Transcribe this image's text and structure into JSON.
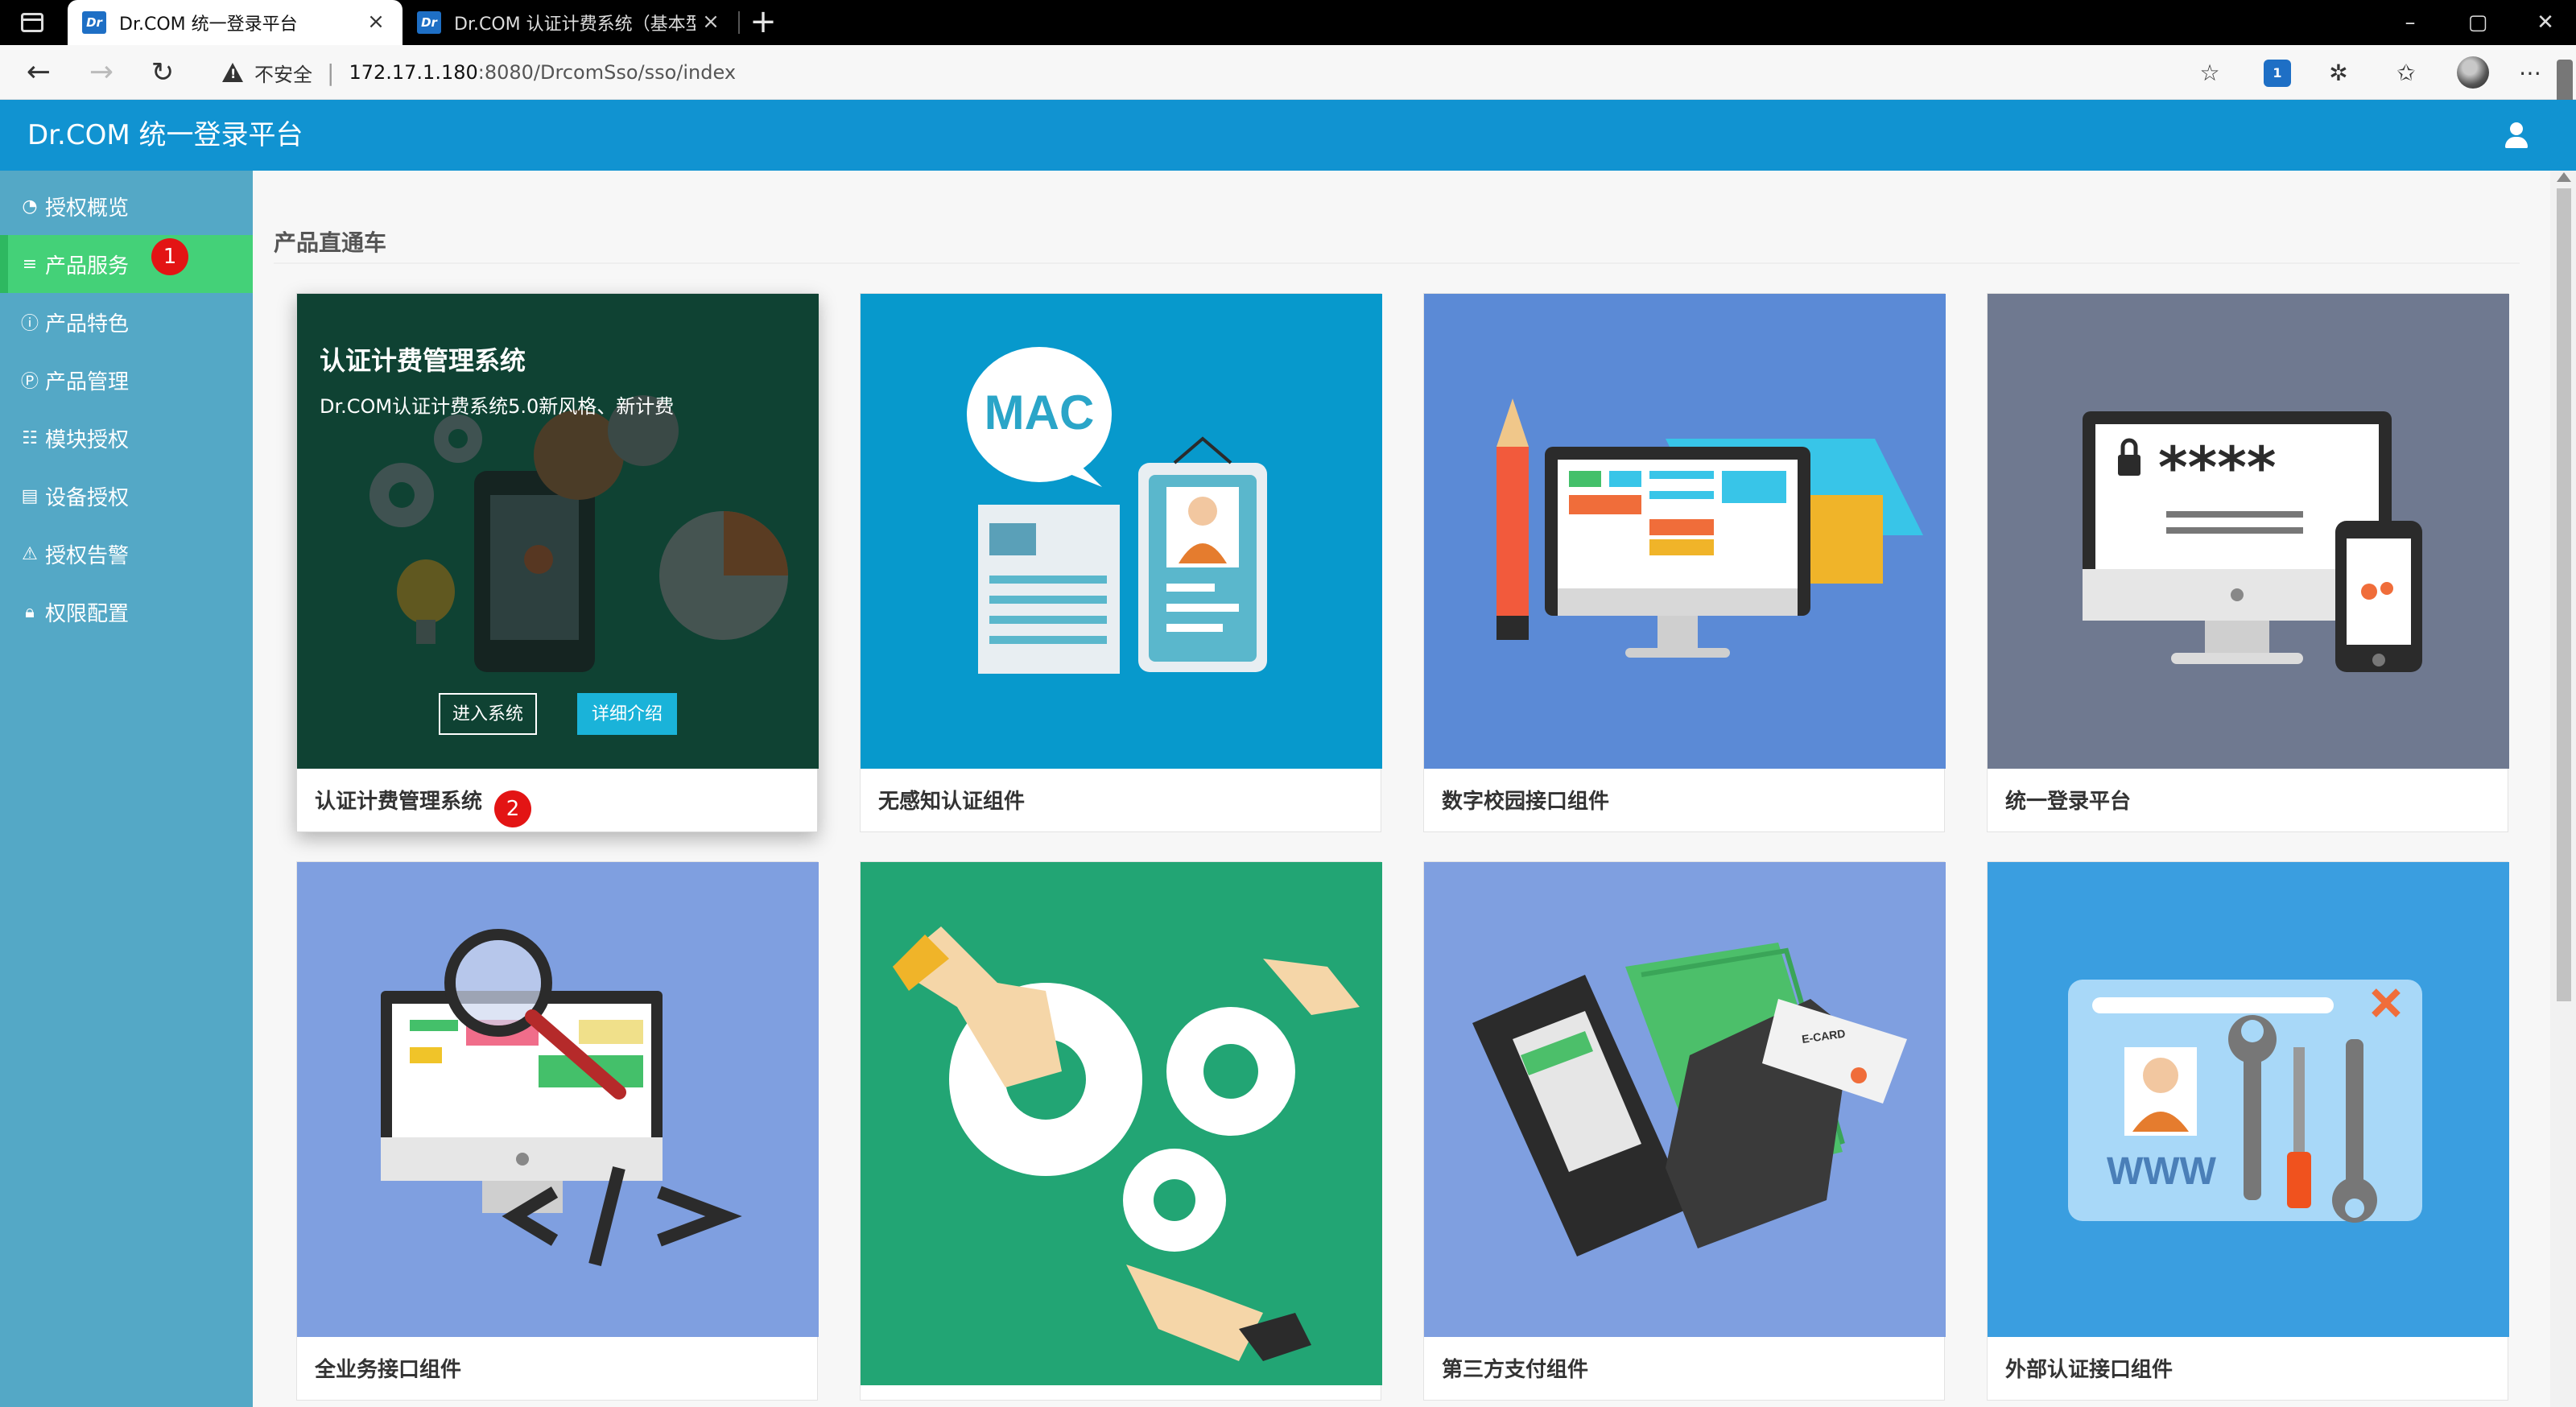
{
  "browser": {
    "tabs": [
      {
        "label": "Dr.COM 统一登录平台",
        "favicon": "Dr",
        "active": true
      },
      {
        "label": "Dr.COM 认证计费系统（基本型）",
        "favicon": "Dr",
        "active": false
      }
    ],
    "address": {
      "security_label": "不安全",
      "url_host": "172.17.1.180",
      "url_rest": ":8080/DrcomSso/sso/index"
    },
    "extension_badge": "1"
  },
  "app": {
    "title": "Dr.COM 统一登录平台"
  },
  "sidebar": {
    "items": [
      {
        "label": "授权概览",
        "icon": "dashboard-icon"
      },
      {
        "label": "产品服务",
        "icon": "list-icon",
        "active": true
      },
      {
        "label": "产品特色",
        "icon": "info-icon"
      },
      {
        "label": "产品管理",
        "icon": "p-circle-icon"
      },
      {
        "label": "模块授权",
        "icon": "table-list-icon"
      },
      {
        "label": "设备授权",
        "icon": "server-icon"
      },
      {
        "label": "授权告警",
        "icon": "warning-icon"
      },
      {
        "label": "权限配置",
        "icon": "lock-icon"
      }
    ]
  },
  "markers": {
    "m1": "1",
    "m2": "2"
  },
  "main": {
    "section_title": "产品直通车",
    "featured": {
      "title": "认证计费管理系统",
      "subtitle": "Dr.COM认证计费系统5.0新风格、新计费",
      "enter_label": "进入系统",
      "detail_label": "详细介绍"
    },
    "cards": [
      {
        "label": "认证计费管理系统",
        "bg": "#1c7a5a"
      },
      {
        "label": "无感知认证组件",
        "bg": "#0799cc"
      },
      {
        "label": "数字校园接口组件",
        "bg": "#5b8ad6"
      },
      {
        "label": "统一登录平台",
        "bg": "#6f7990"
      },
      {
        "label": "全业务接口组件",
        "bg": "#7f9fe0"
      },
      {
        "label": "",
        "bg": "#22a574"
      },
      {
        "label": "第三方支付组件",
        "bg": "#7f9fe0"
      },
      {
        "label": "外部认证接口组件",
        "bg": "#3a9ee0"
      }
    ],
    "illustration_text": {
      "mac": "MAC",
      "stars": "****",
      "www": "WWW",
      "ecard": "E-CARD"
    }
  },
  "colors": {
    "header": "#1193d1",
    "sidebar": "#54a8c6",
    "sidebar_active": "#44d178",
    "marker": "#e31414",
    "detail_button": "#1ab3d9"
  }
}
